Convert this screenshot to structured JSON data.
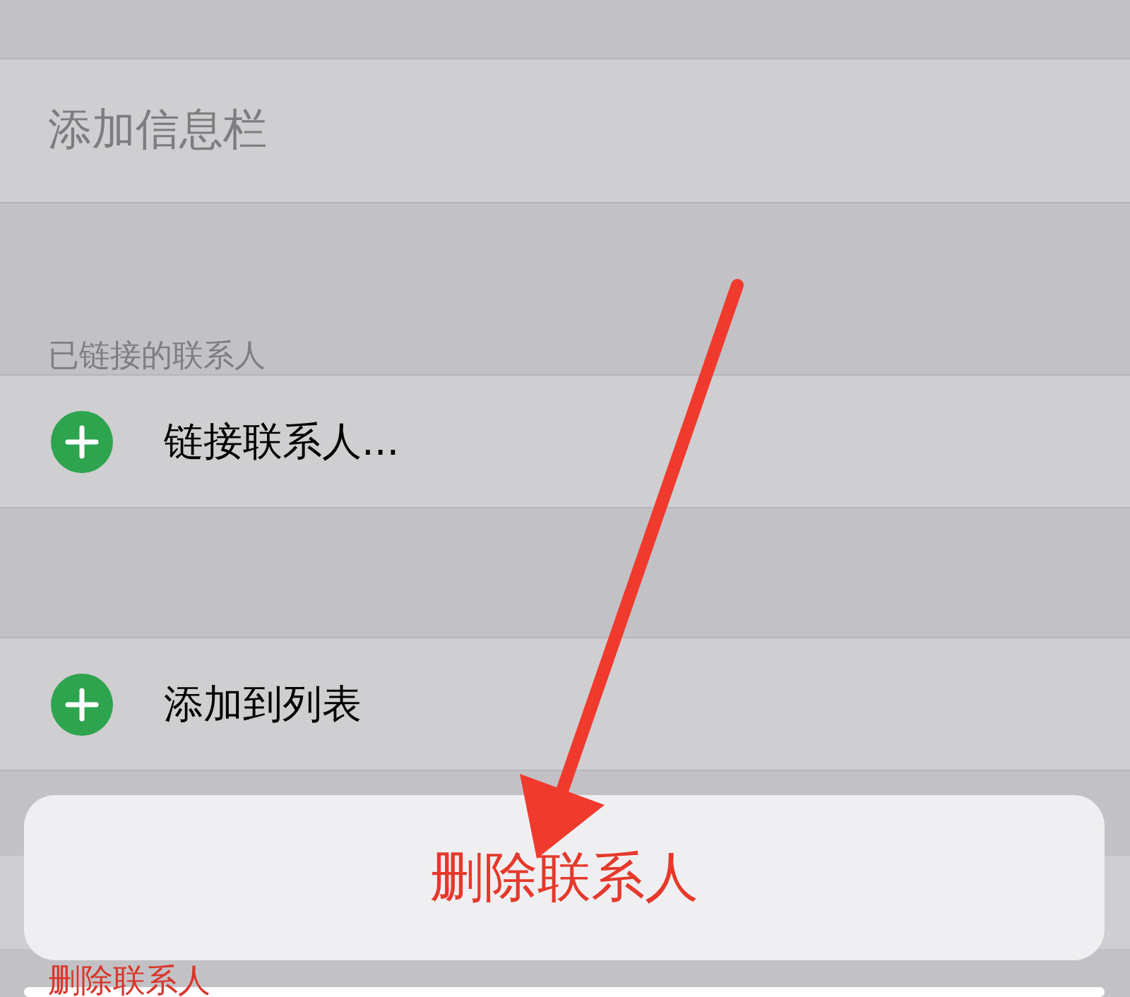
{
  "rows": [
    {
      "kind": "field",
      "label": "添加信息栏"
    },
    {
      "kind": "header",
      "label": "已链接的联系人"
    },
    {
      "kind": "add",
      "label": "链接联系人..."
    },
    {
      "kind": "add",
      "label": "添加到列表"
    },
    {
      "kind": "destructive",
      "label": "删除联系人"
    }
  ],
  "action_sheet": {
    "actions": [
      "删除联系人"
    ]
  }
}
